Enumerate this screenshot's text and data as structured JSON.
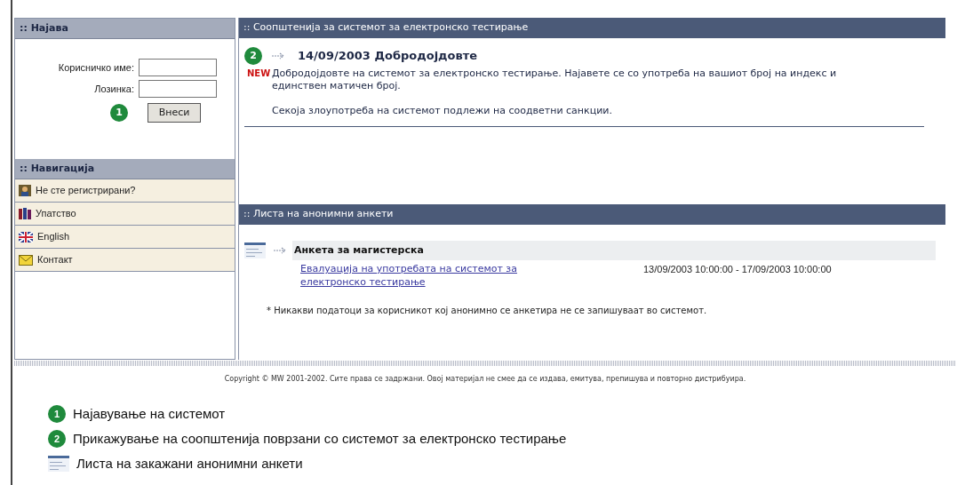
{
  "login": {
    "title": ":: Најава",
    "fields": [
      {
        "label": "Корисничко име:"
      },
      {
        "label": "Лозинка:"
      }
    ],
    "callout": "1",
    "button": "Внеси"
  },
  "navigation": {
    "title": ":: Навигација",
    "items": [
      {
        "kind": "person",
        "label": "Не сте регистрирани?"
      },
      {
        "kind": "books",
        "label": "Упатство"
      },
      {
        "kind": "flag",
        "label": "English"
      },
      {
        "kind": "mail",
        "label": "Контакт"
      }
    ]
  },
  "announcements": {
    "title": ":: Соопштенија за системот за електронско тестирање",
    "callout": "2",
    "heading": "14/09/2003 Добродојдовте",
    "badge": "NEW",
    "paragraphs": [
      "Добродојдовте на системот за електронско тестирање. Најавете се со употреба на вашиот број на индекс и единствен матичен број.",
      "Секоја злоупотреба на системот подлежи на соодветни санкции."
    ]
  },
  "surveys": {
    "title": ":: Листа на анонимни анкети",
    "items": [
      {
        "title": "Анкета за магистерска",
        "link": "Евалуација на употребата на системот за електронско тестирање",
        "period": "13/09/2003 10:00:00 - 17/09/2003 10:00:00"
      }
    ],
    "note": "* Никакви податоци за корисникот кој анонимно се анкетира не се запишуваат во системот."
  },
  "copyright": "Copyright © MW 2001-2002. Сите права се задржани. Овој материјал не смее да се издава, емитува, препишува и повторно дистрибуира.",
  "legend": [
    {
      "kind": "callout",
      "number": "1",
      "text": "Најавување на системот"
    },
    {
      "kind": "callout",
      "number": "2",
      "text": "Прикажување на соопштенија поврзани со системот за електронско тестирање"
    },
    {
      "kind": "list",
      "text": "Листа на закажани анонимни анкети"
    }
  ]
}
